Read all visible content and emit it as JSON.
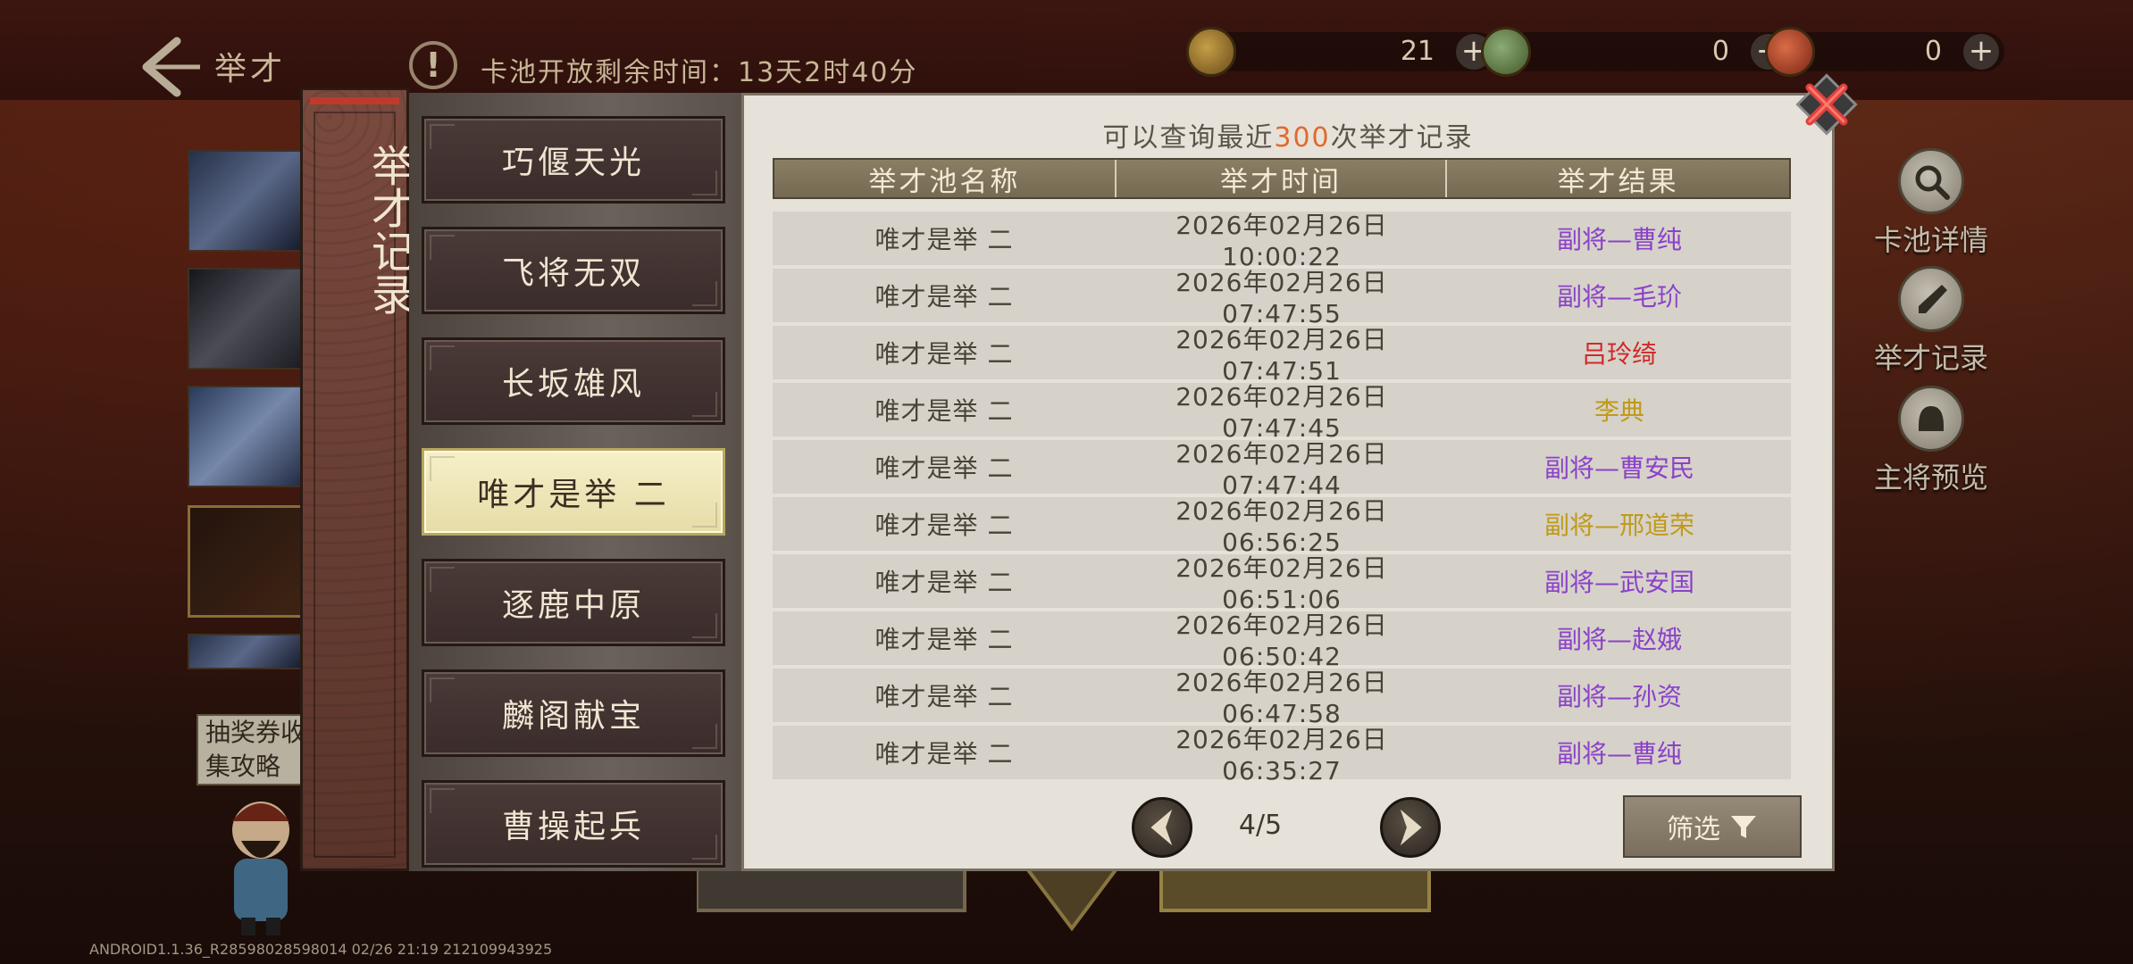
{
  "header": {
    "title": "举才",
    "pool_timer": "卡池开放剩余时间：13天2时40分"
  },
  "currencies": [
    {
      "icon": "gold-coin-icon",
      "value": "21"
    },
    {
      "icon": "jade-token-icon",
      "value": "0"
    },
    {
      "icon": "red-seal-icon",
      "value": "0"
    }
  ],
  "side_menu": {
    "pool_details": "卡池详情",
    "records": "举才记录",
    "preview": "主将预览"
  },
  "left_note": "抽奖券收集攻略",
  "version": "ANDROID1.1.36_R28598028598014 02/26 21:19 212109943925",
  "dialog": {
    "vertical_title": "举才记录",
    "query_hint_prefix": "可以查询最近",
    "query_hint_count": "300",
    "query_hint_suffix": "次举才记录",
    "pools": [
      "巧偃天光",
      "飞将无双",
      "长坂雄风",
      "唯才是举 二",
      "逐鹿中原",
      "麟阁献宝",
      "曹操起兵"
    ],
    "selected_pool_index": 3,
    "columns": [
      "举才池名称",
      "举才时间",
      "举才结果"
    ],
    "rows": [
      {
        "pool": "唯才是举 二",
        "time": "2026年02月26日 10:00:22",
        "result": "副将—曹纯",
        "rarity_color": "#8b42c8"
      },
      {
        "pool": "唯才是举 二",
        "time": "2026年02月26日 07:47:55",
        "result": "副将—毛玠",
        "rarity_color": "#8b42c8"
      },
      {
        "pool": "唯才是举 二",
        "time": "2026年02月26日 07:47:51",
        "result": "吕玲绮",
        "rarity_color": "#cf2a2a"
      },
      {
        "pool": "唯才是举 二",
        "time": "2026年02月26日 07:47:45",
        "result": "李典",
        "rarity_color": "#c09a18"
      },
      {
        "pool": "唯才是举 二",
        "time": "2026年02月26日 07:47:44",
        "result": "副将—曹安民",
        "rarity_color": "#8b42c8"
      },
      {
        "pool": "唯才是举 二",
        "time": "2026年02月26日 06:56:25",
        "result": "副将—邢道荣",
        "rarity_color": "#c09a18"
      },
      {
        "pool": "唯才是举 二",
        "time": "2026年02月26日 06:51:06",
        "result": "副将—武安国",
        "rarity_color": "#8b42c8"
      },
      {
        "pool": "唯才是举 二",
        "time": "2026年02月26日 06:50:42",
        "result": "副将—赵娥",
        "rarity_color": "#8b42c8"
      },
      {
        "pool": "唯才是举 二",
        "time": "2026年02月26日 06:47:58",
        "result": "副将—孙资",
        "rarity_color": "#8b42c8"
      },
      {
        "pool": "唯才是举 二",
        "time": "2026年02月26日 06:35:27",
        "result": "副将—曹纯",
        "rarity_color": "#8b42c8"
      }
    ],
    "page_indicator": "4/5",
    "filter_label": "筛选"
  }
}
